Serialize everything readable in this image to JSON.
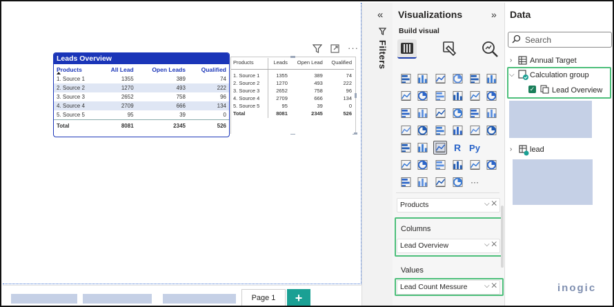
{
  "overview": {
    "title": "Leads Overview",
    "headers": [
      "Products",
      "All Lead",
      "Open Leads",
      "Qualified"
    ],
    "rows": [
      [
        "1. Source 1",
        "1355",
        "389",
        "74"
      ],
      [
        "2. Source 2",
        "1270",
        "493",
        "222"
      ],
      [
        "3. Source 3",
        "2652",
        "758",
        "96"
      ],
      [
        "4. Source 4",
        "2709",
        "666",
        "134"
      ],
      [
        "5. Source 5",
        "95",
        "39",
        "0"
      ]
    ],
    "total": [
      "Total",
      "8081",
      "2345",
      "526"
    ]
  },
  "table2": {
    "headers": [
      "Products",
      "Leads",
      "Open Lead",
      "Qualified"
    ],
    "rows": [
      [
        "1. Source 1",
        "1355",
        "389",
        "74"
      ],
      [
        "2. Source 2",
        "1270",
        "493",
        "222"
      ],
      [
        "3. Source 3",
        "2652",
        "758",
        "96"
      ],
      [
        "4. Source 4",
        "2709",
        "666",
        "134"
      ],
      [
        "5. Source 5",
        "95",
        "39",
        "0"
      ]
    ],
    "total": [
      "Total",
      "8081",
      "2345",
      "526"
    ],
    "header_icons": [
      "filter-icon",
      "focus-mode-icon",
      "more-options-icon"
    ]
  },
  "pagebar": {
    "page_label": "Page 1",
    "add_label": "+"
  },
  "filters": {
    "label": "Filters"
  },
  "viz": {
    "title": "Visualizations",
    "build_label": "Build visual",
    "wells": {
      "rows_value": "Products",
      "columns_label": "Columns",
      "columns_value": "Lead Overview",
      "values_label": "Values",
      "values_value": "Lead Count Messure"
    }
  },
  "data": {
    "title": "Data",
    "search_placeholder": "Search",
    "tree": {
      "annual_target": "Annual Target",
      "calc_group": "Calculation group",
      "lead_overview": "Lead Overview",
      "lead": "lead"
    }
  },
  "logo": "inogic",
  "colors": {
    "accent": "#1a35b8",
    "highlight": "#4cbf7a",
    "add_page": "#1aa094"
  }
}
